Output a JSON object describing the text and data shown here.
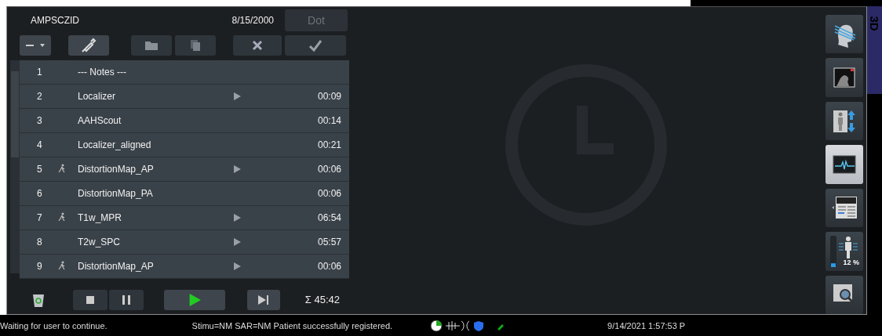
{
  "header": {
    "patient_id": "AMPSCZID",
    "date": "8/15/2000",
    "dot_button": "Dot"
  },
  "protocol_rows": [
    {
      "number": "1",
      "name": "--- Notes ---",
      "patient_icon": false,
      "has_play": false
    },
    {
      "number": "2",
      "name": "Localizer",
      "patient_icon": false,
      "has_play": true,
      "duration": "00:09"
    },
    {
      "number": "3",
      "name": "AAHScout",
      "patient_icon": false,
      "has_play": false,
      "duration": "00:14"
    },
    {
      "number": "4",
      "name": "Localizer_aligned",
      "patient_icon": false,
      "has_play": false,
      "duration": "00:21"
    },
    {
      "number": "5",
      "name": "DistortionMap_AP",
      "patient_icon": true,
      "has_play": true,
      "duration": "00:06"
    },
    {
      "number": "6",
      "name": "DistortionMap_PA",
      "patient_icon": false,
      "has_play": false,
      "duration": "00:06"
    },
    {
      "number": "7",
      "name": "T1w_MPR",
      "patient_icon": true,
      "has_play": true,
      "duration": "06:54"
    },
    {
      "number": "8",
      "name": "T2w_SPC",
      "patient_icon": false,
      "has_play": true,
      "duration": "05:57"
    },
    {
      "number": "9",
      "name": "DistortionMap_AP",
      "patient_icon": true,
      "has_play": true,
      "duration": "00:06"
    }
  ],
  "total_time": "Σ 45:42",
  "side_buttons": [
    {
      "kind": "head",
      "selected": false
    },
    {
      "kind": "viewer",
      "selected": false
    },
    {
      "kind": "table",
      "selected": false
    },
    {
      "kind": "physio",
      "selected": true
    },
    {
      "kind": "list",
      "selected": false
    },
    {
      "kind": "sar",
      "selected": false,
      "reading": "12 %",
      "level": 0.12
    },
    {
      "kind": "search",
      "selected": false
    }
  ],
  "side_tab": "3D",
  "status_bar": {
    "message": "Waiting for user to continue.",
    "info": "Stimu=NM SAR=NM Patient successfully registered.",
    "datetime": "9/14/2021 1:57:53 P"
  }
}
